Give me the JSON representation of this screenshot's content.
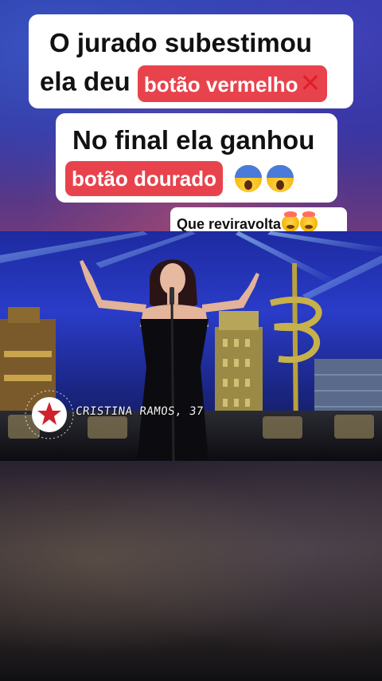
{
  "overlay": {
    "line1": "O jurado subestimou",
    "line2_prefix": "ela deu",
    "line2_pill": "botão vermelho",
    "line3": "No final ela ganhou",
    "line4_pill": "botão dourado",
    "reaction_text": "Que reviravolta"
  },
  "video": {
    "caption": "CRISTINA RAMOS, 37",
    "logo_icon": "star-badge-icon"
  },
  "colors": {
    "pill_red": "#e8434d",
    "card_bg": "#ffffff",
    "stage_blue": "#2a3cc8"
  }
}
